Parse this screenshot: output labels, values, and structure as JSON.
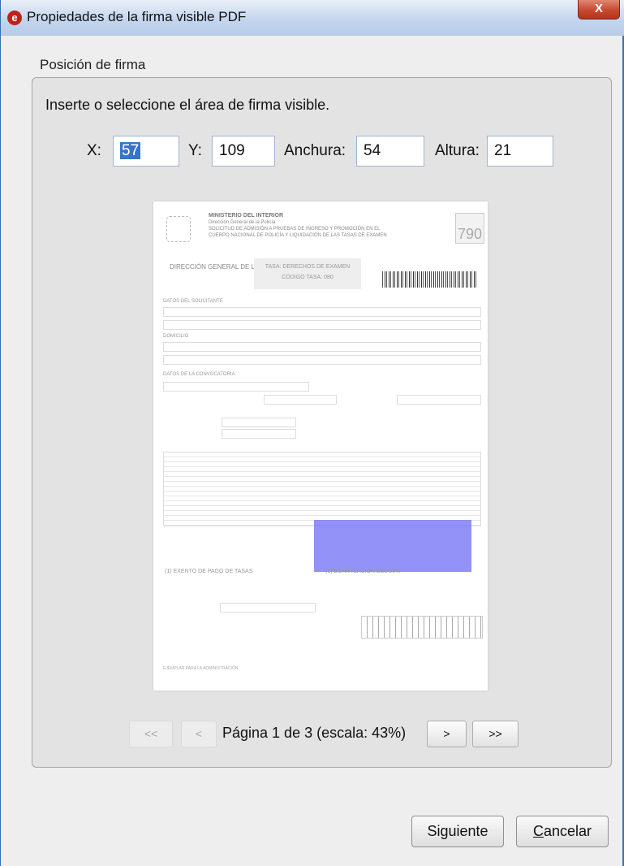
{
  "window": {
    "title": "Propiedades de la firma visible PDF",
    "close_label": "X",
    "app_icon": "red-circle-e-icon"
  },
  "group": {
    "legend": "Posición de firma",
    "instruction": "Inserte o seleccione el área de firma visible."
  },
  "fields": {
    "x_label": "X:",
    "x_value": "57",
    "y_label": "Y:",
    "y_value": "109",
    "width_label": "Anchura:",
    "width_value": "54",
    "height_label": "Altura:",
    "height_value": "21"
  },
  "preview": {
    "doc_ministry": "MINISTERIO DEL INTERIOR",
    "doc_code": "790",
    "doc_agency": "DIRECCIÓN GENERAL DE LA POLICÍA",
    "doc_tasa": "TASA: DERECHOS DE EXAMEN",
    "doc_tasa_code": "CÓDIGO TASA: 080",
    "signature_area_color": "#6e6ef5"
  },
  "pagination": {
    "first_label": "<<",
    "prev_label": "<",
    "page_text": "Página 1 de 3 (escala: 43%)",
    "next_label": ">",
    "last_label": ">>"
  },
  "buttons": {
    "next_label": "Siguiente",
    "cancel_first": "C",
    "cancel_rest": "ancelar"
  }
}
